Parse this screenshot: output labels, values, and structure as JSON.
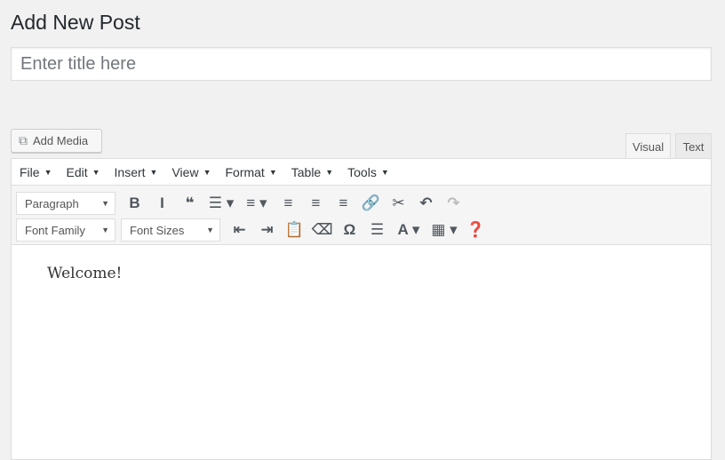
{
  "page": {
    "title": "Add New Post"
  },
  "title_input": {
    "placeholder": "Enter title here",
    "value": ""
  },
  "add_media": {
    "label": "Add Media",
    "icon": "media-icon"
  },
  "tabs": [
    {
      "label": "Visual",
      "active": true
    },
    {
      "label": "Text",
      "active": false
    }
  ],
  "menubar": [
    "File",
    "Edit",
    "Insert",
    "View",
    "Format",
    "Table",
    "Tools"
  ],
  "toolbar": {
    "format_select": "Paragraph",
    "font_family_select": "Font Family",
    "font_size_select": "Font Sizes",
    "row1": [
      {
        "name": "bold",
        "glyph": "B"
      },
      {
        "name": "italic",
        "glyph": "I"
      },
      {
        "name": "blockquote",
        "glyph": "❝"
      },
      {
        "name": "bullet-list",
        "glyph": "☰ ▾"
      },
      {
        "name": "numbered-list",
        "glyph": "≡ ▾"
      },
      {
        "name": "align-left",
        "glyph": "≡"
      },
      {
        "name": "align-center",
        "glyph": "≡"
      },
      {
        "name": "align-right",
        "glyph": "≡"
      },
      {
        "name": "link",
        "glyph": "🔗"
      },
      {
        "name": "unlink",
        "glyph": "✂"
      },
      {
        "name": "undo",
        "glyph": "↶"
      },
      {
        "name": "redo",
        "glyph": "↷",
        "disabled": true
      }
    ],
    "row2": [
      {
        "name": "outdent",
        "glyph": "⇤"
      },
      {
        "name": "indent",
        "glyph": "⇥"
      },
      {
        "name": "paste-as-text",
        "glyph": "📋"
      },
      {
        "name": "clear-formatting",
        "glyph": "⌫"
      },
      {
        "name": "special-character",
        "glyph": "Ω"
      },
      {
        "name": "horizontal-rule",
        "glyph": "☰"
      },
      {
        "name": "text-color",
        "glyph": "A ▾"
      },
      {
        "name": "table",
        "glyph": "▦ ▾"
      },
      {
        "name": "help",
        "glyph": "❓"
      }
    ]
  },
  "content": {
    "text": "Welcome!"
  }
}
